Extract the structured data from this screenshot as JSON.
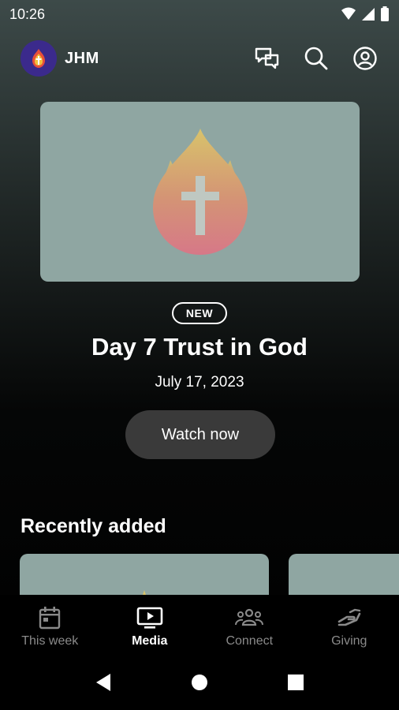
{
  "status_bar": {
    "time": "10:26",
    "icons": [
      "wifi-icon",
      "cell-signal-icon",
      "battery-icon"
    ]
  },
  "header": {
    "brand": "JHM",
    "logo_icon": "flame-cross-logo",
    "actions": [
      "chat-icon",
      "search-icon",
      "account-icon"
    ]
  },
  "hero": {
    "badge": "NEW",
    "title": "Day 7 Trust in God",
    "date": "July 17, 2023",
    "cta_label": "Watch now",
    "artwork_icon": "flame-cross-icon"
  },
  "recent": {
    "title": "Recently added"
  },
  "bottom_nav": {
    "items": [
      {
        "label": "This week",
        "icon": "calendar-icon",
        "active": false
      },
      {
        "label": "Media",
        "icon": "tv-play-icon",
        "active": true
      },
      {
        "label": "Connect",
        "icon": "group-icon",
        "active": false
      },
      {
        "label": "Giving",
        "icon": "giving-hand-icon",
        "active": false
      }
    ]
  },
  "system_nav": [
    "back-icon",
    "home-icon",
    "recents-icon"
  ],
  "colors": {
    "card_background": "#8fa6a2",
    "logo_background": "#3b2a8c",
    "watch_button": "#3a3a3a",
    "inactive_nav": "#8a8a8a"
  }
}
